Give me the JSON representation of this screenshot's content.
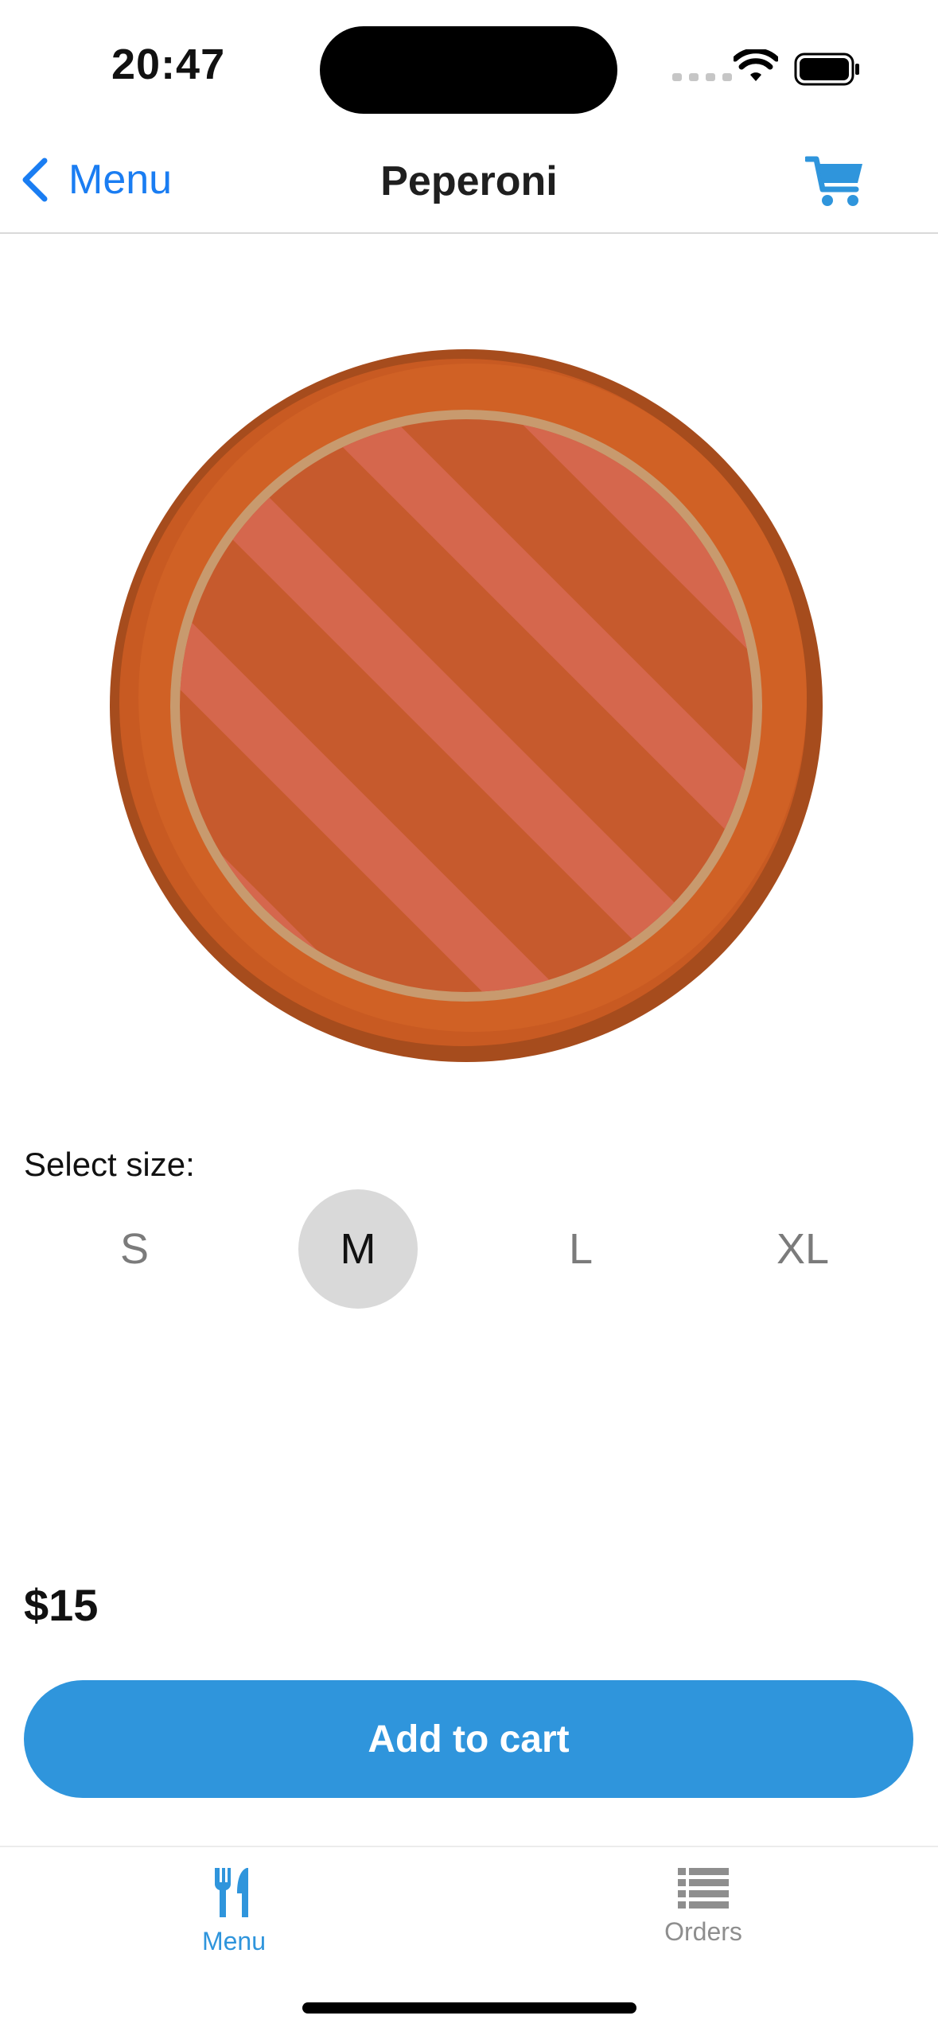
{
  "status_bar": {
    "time": "20:47",
    "icons": [
      "cellular-signal-icon",
      "wifi-icon",
      "battery-icon"
    ]
  },
  "nav": {
    "back_label": "Menu",
    "back_icon": "chevron-left-icon",
    "title": "Peperoni",
    "cart_icon": "cart-icon"
  },
  "product": {
    "image_icon": "pizza-icon",
    "size_prompt": "Select size:",
    "sizes": [
      "S",
      "M",
      "L",
      "XL"
    ],
    "selected_size": "M",
    "price": "$15",
    "add_button_label": "Add to cart"
  },
  "tab_bar": {
    "tabs": [
      {
        "label": "Menu",
        "icon": "utensils-icon",
        "active": true
      },
      {
        "label": "Orders",
        "icon": "list-icon",
        "active": false
      }
    ]
  },
  "colors": {
    "accent": "#2f95dc",
    "ios_blue": "#1a7df2",
    "selected_bg": "#d9d9d9",
    "inactive_text": "#8e8e8e"
  }
}
